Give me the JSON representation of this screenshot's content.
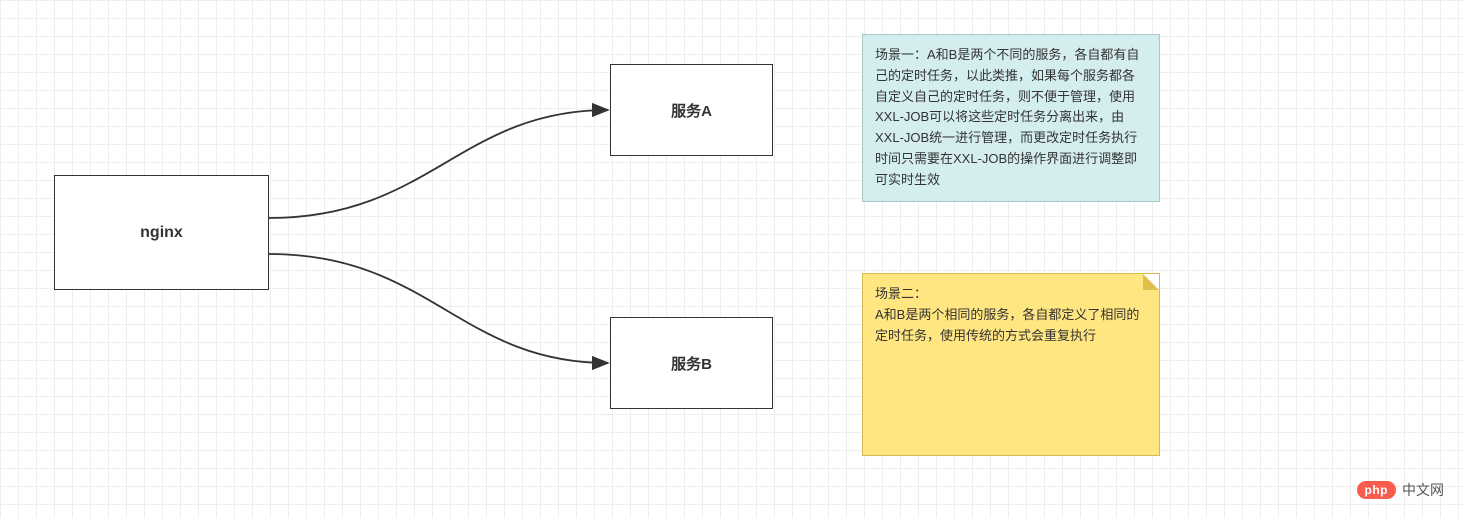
{
  "diagram": {
    "nodes": {
      "nginx": {
        "label": "nginx"
      },
      "serviceA": {
        "label": "服务A"
      },
      "serviceB": {
        "label": "服务B"
      }
    },
    "edges": [
      {
        "from": "nginx",
        "to": "serviceA",
        "directed": true
      },
      {
        "from": "nginx",
        "to": "serviceB",
        "directed": true
      }
    ],
    "notes": {
      "scenario1": {
        "text": "场景一：A和B是两个不同的服务，各自都有自己的定时任务，以此类推，如果每个服务都各自定义自己的定时任务，则不便于管理，使用XXL-JOB可以将这些定时任务分离出来，由XXL-JOB统一进行管理，而更改定时任务执行时间只需要在XXL-JOB的操作界面进行调整即可实时生效"
      },
      "scenario2": {
        "title": "场景二：",
        "text": "A和B是两个相同的服务，各自都定义了相同的定时任务，使用传统的方式会重复执行"
      }
    }
  },
  "branding": {
    "logo": "php",
    "site": "中文网"
  }
}
